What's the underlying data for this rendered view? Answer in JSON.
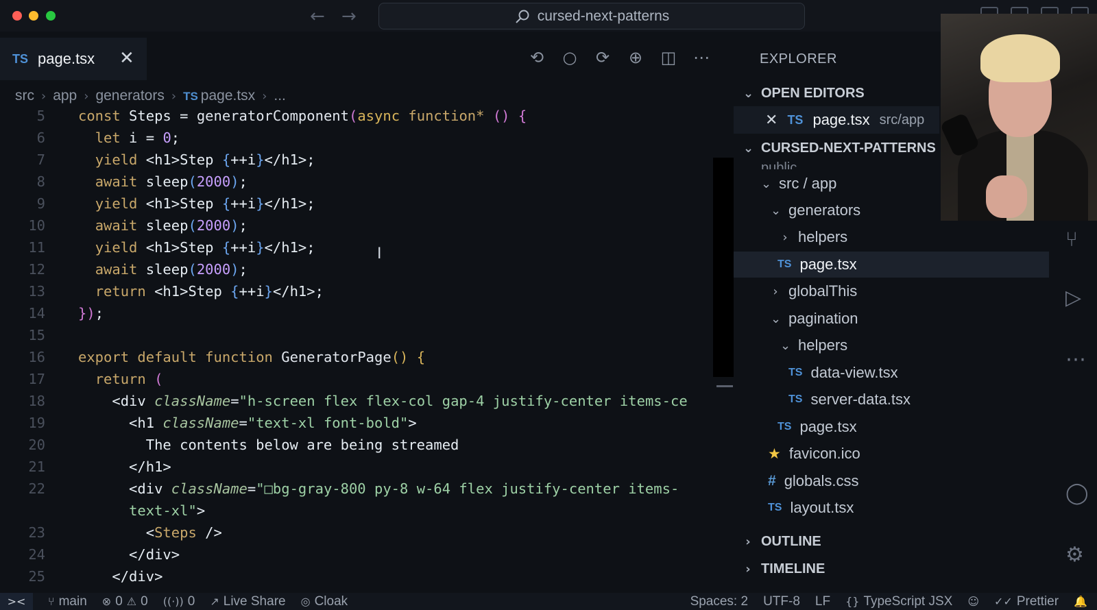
{
  "window": {
    "search_text": "cursed-next-patterns"
  },
  "tab": {
    "badge": "TS",
    "title": "page.tsx"
  },
  "breadcrumb": {
    "items": [
      "src",
      "app",
      "generators"
    ],
    "file_badge": "TS",
    "file": "page.tsx",
    "tail": "..."
  },
  "editor": {
    "lines": [
      {
        "n": "5"
      },
      {
        "n": "6"
      },
      {
        "n": "7"
      },
      {
        "n": "8"
      },
      {
        "n": "9"
      },
      {
        "n": "10"
      },
      {
        "n": "11"
      },
      {
        "n": "12"
      },
      {
        "n": "13"
      },
      {
        "n": "14"
      },
      {
        "n": "15"
      },
      {
        "n": "16"
      },
      {
        "n": "17"
      },
      {
        "n": "18"
      },
      {
        "n": "19"
      },
      {
        "n": "20"
      },
      {
        "n": "21"
      },
      {
        "n": "22"
      },
      {
        "n": ""
      },
      {
        "n": "23"
      },
      {
        "n": "24"
      },
      {
        "n": "25"
      }
    ]
  },
  "explorer": {
    "title": "EXPLORER",
    "open_editors_label": "OPEN EDITORS",
    "open_editor": {
      "badge": "TS",
      "name": "page.tsx",
      "path": "src/app"
    },
    "project_label": "CURSED-NEXT-PATTERNS",
    "partial_item": "public",
    "tree": [
      {
        "label": "src / app",
        "kind": "folder-open"
      },
      {
        "label": "generators",
        "kind": "folder-open"
      },
      {
        "label": "helpers",
        "kind": "folder-closed"
      },
      {
        "label": "page.tsx",
        "kind": "ts",
        "badge": "TS"
      },
      {
        "label": "globalThis",
        "kind": "folder-closed"
      },
      {
        "label": "pagination",
        "kind": "folder-open"
      },
      {
        "label": "helpers",
        "kind": "folder-open"
      },
      {
        "label": "data-view.tsx",
        "kind": "ts",
        "badge": "TS"
      },
      {
        "label": "server-data.tsx",
        "kind": "ts",
        "badge": "TS"
      },
      {
        "label": "page.tsx",
        "kind": "ts",
        "badge": "TS"
      },
      {
        "label": "favicon.ico",
        "kind": "star"
      },
      {
        "label": "globals.css",
        "kind": "hash",
        "badge": "#"
      },
      {
        "label": "layout.tsx",
        "kind": "ts",
        "badge": "TS"
      }
    ],
    "outline_label": "OUTLINE",
    "timeline_label": "TIMELINE"
  },
  "statusbar": {
    "branch": "main",
    "errors": "0",
    "warnings": "0",
    "ports": "0",
    "live_share": "Live Share",
    "cloak": "Cloak",
    "spaces": "Spaces: 2",
    "encoding": "UTF-8",
    "eol": "LF",
    "language": "TypeScript JSX",
    "prettier": "Prettier"
  },
  "colors": {
    "background": "#0e1116",
    "ts_badge": "#4f92d8",
    "keyword": "#c9a86a",
    "string": "#9ed1a6",
    "number": "#c8a0ff"
  }
}
